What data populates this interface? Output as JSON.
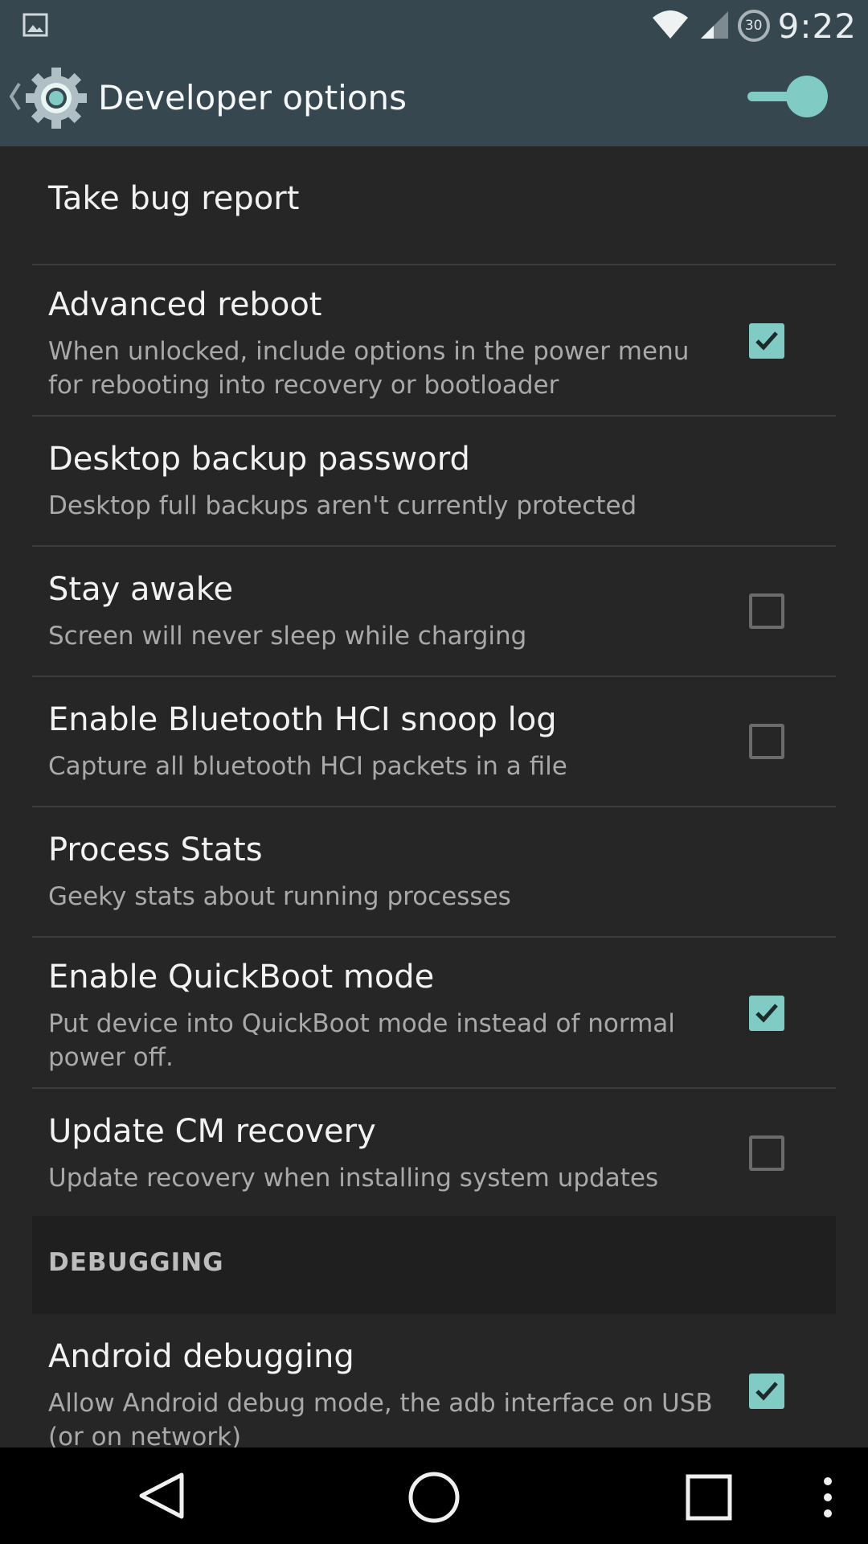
{
  "status_bar": {
    "time": "9:22",
    "battery_level": "30",
    "icons": [
      "image-notification-icon",
      "wifi-icon",
      "cell-signal-icon",
      "battery-circle-icon"
    ]
  },
  "action_bar": {
    "title": "Developer options",
    "master_switch_on": true,
    "accent_color": "#80cbc4"
  },
  "preferences": [
    {
      "title": "Take bug report",
      "summary": "",
      "checkbox": null
    },
    {
      "title": "Advanced reboot",
      "summary": "When unlocked, include options in the power menu for rebooting into recovery or bootloader",
      "checkbox": true
    },
    {
      "title": "Desktop backup password",
      "summary": "Desktop full backups aren't currently protected",
      "checkbox": null
    },
    {
      "title": "Stay awake",
      "summary": "Screen will never sleep while charging",
      "checkbox": false
    },
    {
      "title": "Enable Bluetooth HCI snoop log",
      "summary": "Capture all bluetooth HCI packets in a file",
      "checkbox": false
    },
    {
      "title": "Process Stats",
      "summary": "Geeky stats about running processes",
      "checkbox": null
    },
    {
      "title": "Enable QuickBoot mode",
      "summary": "Put device into QuickBoot mode instead of normal power off.",
      "checkbox": true
    },
    {
      "title": "Update CM recovery",
      "summary": "Update recovery when installing system updates",
      "checkbox": false
    }
  ],
  "section": {
    "header": "DEBUGGING",
    "items": [
      {
        "title": "Android debugging",
        "summary": "Allow Android debug mode, the adb interface on USB (or on network)",
        "checkbox": true
      }
    ]
  },
  "nav_bar": {
    "icons": [
      "back-icon",
      "home-icon",
      "recents-icon",
      "overflow-menu-icon"
    ]
  }
}
